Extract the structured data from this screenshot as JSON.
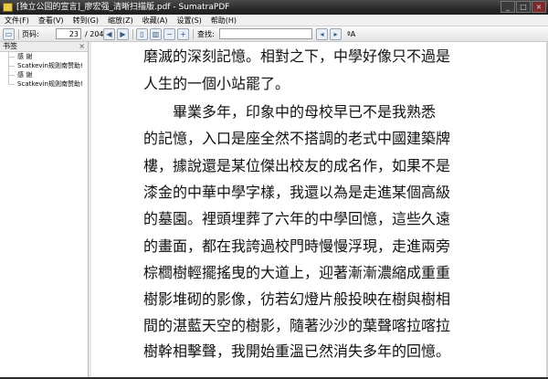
{
  "window": {
    "title": "[独立公园的宣言]_廖宏强_清晰扫描版.pdf - SumatraPDF",
    "controls": [
      "_",
      "□",
      "×"
    ]
  },
  "menu": [
    "文件(F)",
    "查看(V)",
    "转到(G)",
    "缩放(Z)",
    "收藏(A)",
    "设置(S)",
    "帮助(H)"
  ],
  "toolbar": {
    "page_label": "页码:",
    "current_page": "23",
    "total_pages": "/ 204",
    "find_label": "查找:",
    "find_value": "",
    "match_case_label": "ªA"
  },
  "sidebar": {
    "header": "书签",
    "close": "×",
    "items": [
      "感 谢",
      "Scatkevin规则南赞助!",
      "感 谢",
      "Scatkevin规则南赞助!"
    ]
  },
  "document": {
    "lines": [
      "磨滅的深刻記憶。相對之下，中學好像只不過是",
      "人生的一個小站罷了。",
      "畢業多年，印象中的母校早已不是我熟悉",
      "的記憶，入口是座全然不搭調的老式中國建築牌",
      "樓，據說還是某位傑出校友的成名作，如果不是",
      "漆金的中華中學字樣，我還以為是走進某個高級",
      "的墓園。裡頭埋葬了六年的中學回憶，這些久遠",
      "的畫面，都在我誇過校門時慢慢浮現，走進兩旁",
      "棕櫚樹輕擺搖曳的大道上，迎著漸漸濃縮成重重",
      "樹影堆砌的影像，彷若幻燈片般投映在樹與樹相",
      "間的湛藍天空的樹影，隨著沙沙的葉聲喀拉喀拉",
      "樹幹相擊聲，我開始重溫已然消失多年的回憶。"
    ]
  },
  "icons": {
    "app": "sumatra-app-icon",
    "open": "folder-open-icon",
    "back": "arrow-left-icon",
    "forward": "arrow-right-icon",
    "single_page": "single-page-icon",
    "facing": "facing-pages-icon",
    "zoom_out": "zoom-out-icon",
    "zoom_in": "zoom-in-icon",
    "prev_match": "find-prev-icon",
    "next_match": "find-next-icon"
  }
}
